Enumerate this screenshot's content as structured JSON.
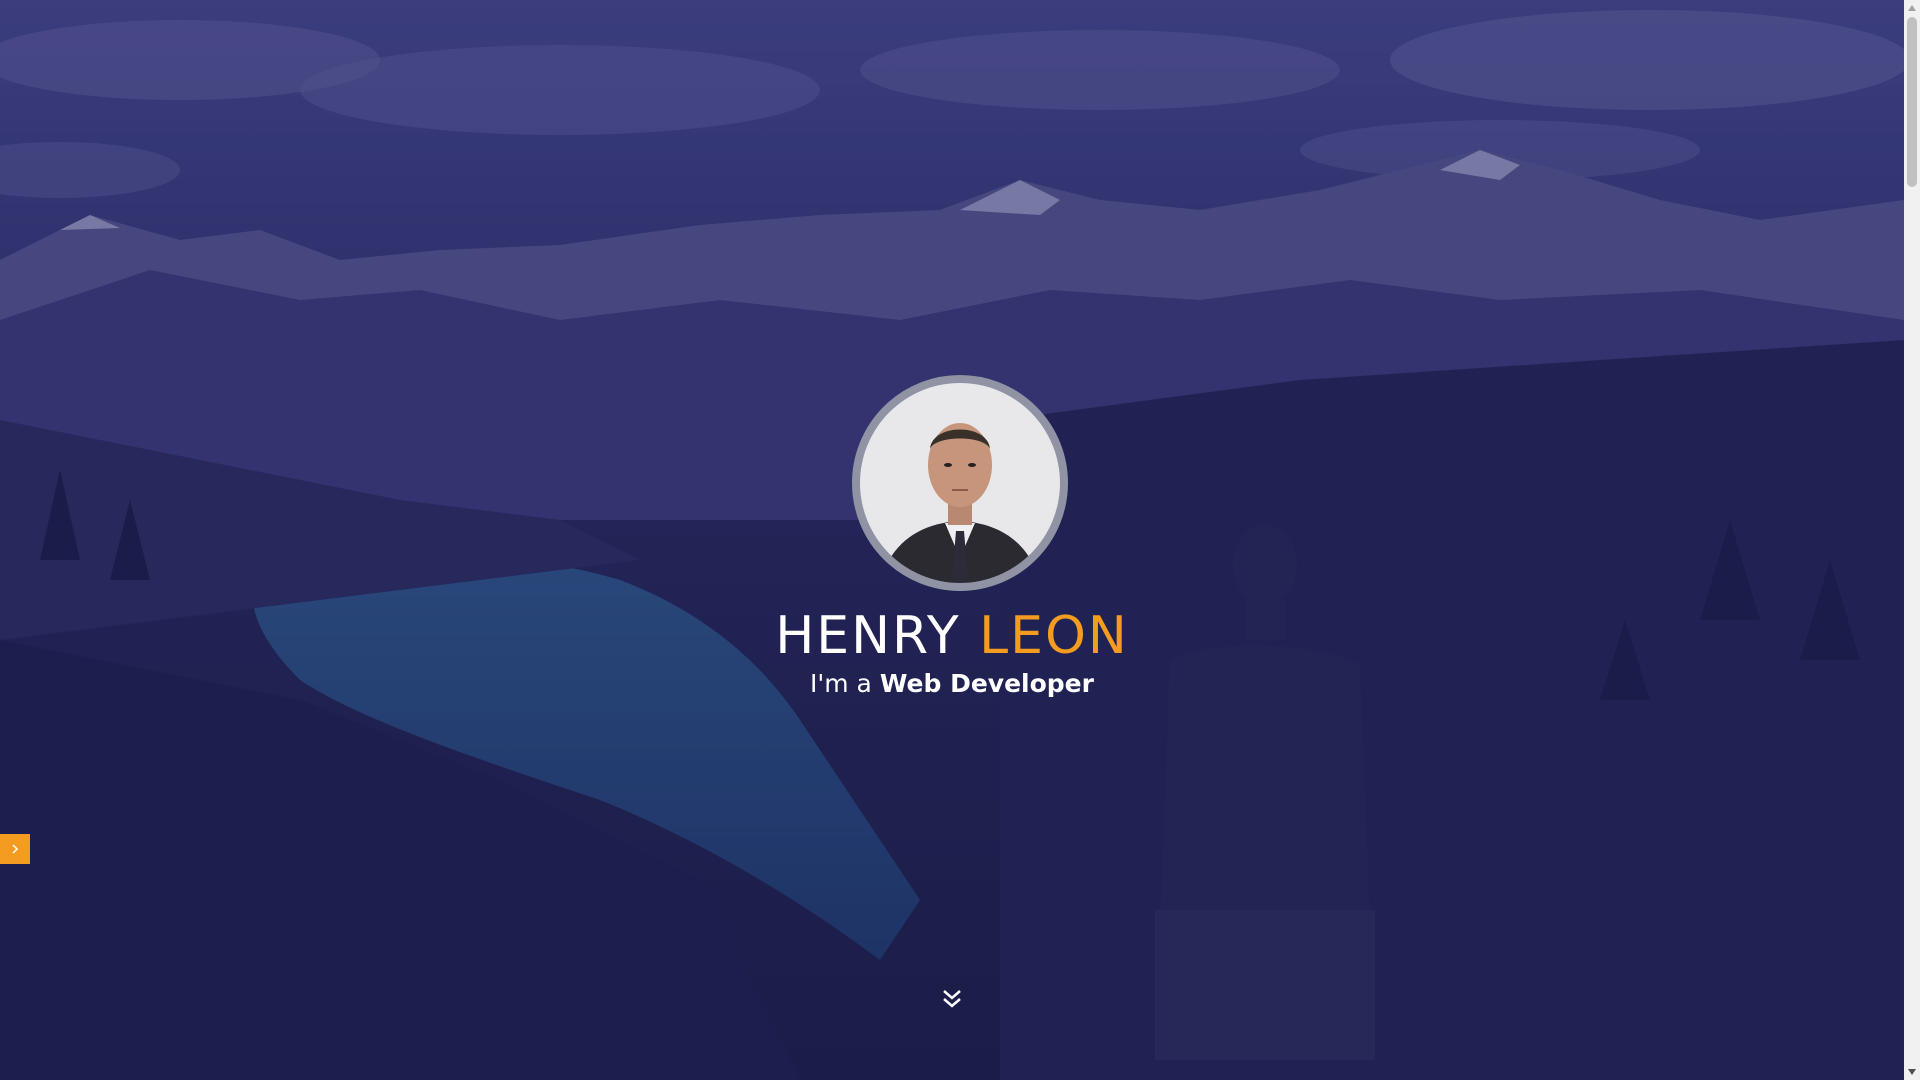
{
  "hero": {
    "name_first": "HENRY",
    "name_last": "LEON",
    "tagline_prefix": "I'm a",
    "tagline_role": "Web Developer",
    "accent_color": "#f39c1f",
    "overlay_color": "#201e5f"
  },
  "icons": {
    "side_toggle": "chevron-right-icon",
    "scroll_down": "double-chevron-down-icon",
    "avatar": "profile-photo"
  },
  "scrollbar": {
    "position_fraction": 0.0
  }
}
